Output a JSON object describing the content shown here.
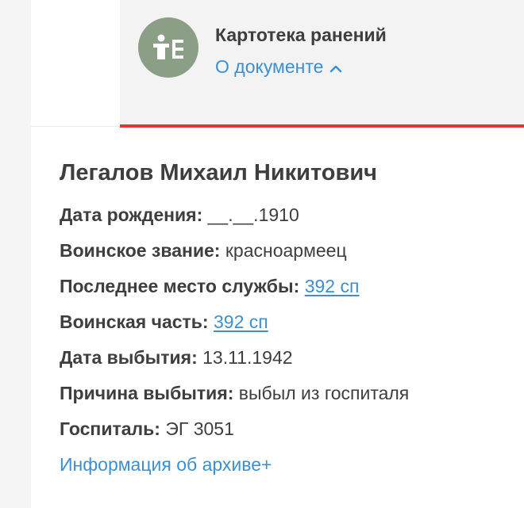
{
  "document": {
    "title": "Картотека ранений",
    "about_label": "О документе",
    "icon": "document-person-icon"
  },
  "person": {
    "name": "Легалов Михаил Никитович",
    "fields": [
      {
        "label": "Дата рождения:",
        "value": "__.__.1910"
      },
      {
        "label": "Воинское звание:",
        "value": "красноармеец"
      },
      {
        "label": "Последнее место службы:",
        "link": "392 сп"
      },
      {
        "label": "Воинская часть:",
        "link": "392 сп"
      },
      {
        "label": "Дата выбытия:",
        "value": "13.11.1942"
      },
      {
        "label": "Причина выбытия:",
        "value": "выбыл из госпиталя"
      },
      {
        "label": "Госпиталь:",
        "value": "ЭГ 3051"
      }
    ]
  },
  "archive_link": "Информация об архиве+",
  "colors": {
    "accent_link": "#3d8fd1",
    "header_border": "#d9373b",
    "icon_bg": "#8b9e86"
  }
}
